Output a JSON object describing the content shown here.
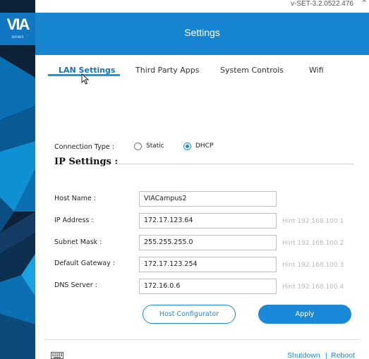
{
  "app": {
    "brand_logo": "VIA",
    "brand_sub": "KRAMER",
    "version": "v-SET-3.2.0522.476",
    "title": "Settings"
  },
  "tabs": [
    {
      "label": "LAN Settings",
      "active": true
    },
    {
      "label": "Third Party Apps",
      "active": false
    },
    {
      "label": "System Controls",
      "active": false
    },
    {
      "label": "Wifi",
      "active": false
    }
  ],
  "connection": {
    "label": "Connection Type :",
    "options": [
      {
        "label": "Static",
        "selected": false
      },
      {
        "label": "DHCP",
        "selected": true
      }
    ]
  },
  "ip_settings": {
    "title": "IP Settings :",
    "fields": [
      {
        "label": "Host Name :",
        "value": "VIACampus2",
        "hint": ""
      },
      {
        "label": "IP Address :",
        "value": "172.17.123.64",
        "hint": "Hint 192.168.100.1"
      },
      {
        "label": "Subnet Mask :",
        "value": "255.255.255.0",
        "hint": "Hint 192.168.100.2"
      },
      {
        "label": "Default Gateway :",
        "value": "172.17.123.254",
        "hint": "Hint 192.168.100.3"
      },
      {
        "label": "DNS Server :",
        "value": "172.16.0.6",
        "hint": "Hint 192.168.100.4"
      }
    ]
  },
  "buttons": {
    "host_configurator": "Host Configurator",
    "apply": "Apply"
  },
  "footer": {
    "shutdown": "Shutdown",
    "separator": "|",
    "reboot": "Reboot"
  },
  "colors": {
    "header": "#1684d1",
    "accent": "#1a8ad8",
    "sidebar": "#0d2238"
  },
  "icons": {
    "cursor": "cursor-arrow-icon",
    "keyboard": "keyboard-icon",
    "collapse": "chevron-up-icon"
  }
}
